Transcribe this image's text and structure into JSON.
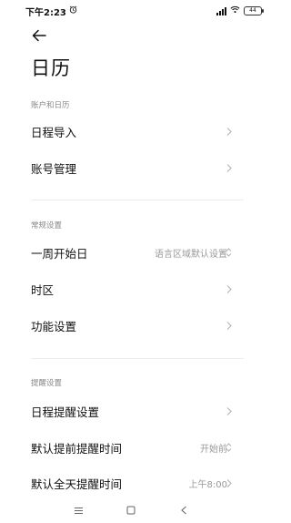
{
  "status_bar": {
    "time": "下午2:23",
    "battery": "44"
  },
  "header": {
    "title": "日历"
  },
  "sections": [
    {
      "header": "账户和日历",
      "items": [
        {
          "label": "日程导入",
          "value": ""
        },
        {
          "label": "账号管理",
          "value": ""
        }
      ]
    },
    {
      "header": "常规设置",
      "items": [
        {
          "label": "一周开始日",
          "value": "语言区域默认设置"
        },
        {
          "label": "时区",
          "value": ""
        },
        {
          "label": "功能设置",
          "value": ""
        }
      ]
    },
    {
      "header": "提醒设置",
      "items": [
        {
          "label": "日程提醒设置",
          "value": ""
        },
        {
          "label": "默认提前提醒时间",
          "value": "开始前"
        },
        {
          "label": "默认全天提醒时间",
          "value": "上午8:00"
        }
      ]
    }
  ],
  "icons": {
    "back": "arrow-left-icon",
    "chevron": "chevron-right-icon",
    "updown": "up-down-chevron-icon",
    "nav_menu": "menu-icon",
    "nav_home": "square-icon",
    "nav_back": "triangle-back-icon"
  }
}
